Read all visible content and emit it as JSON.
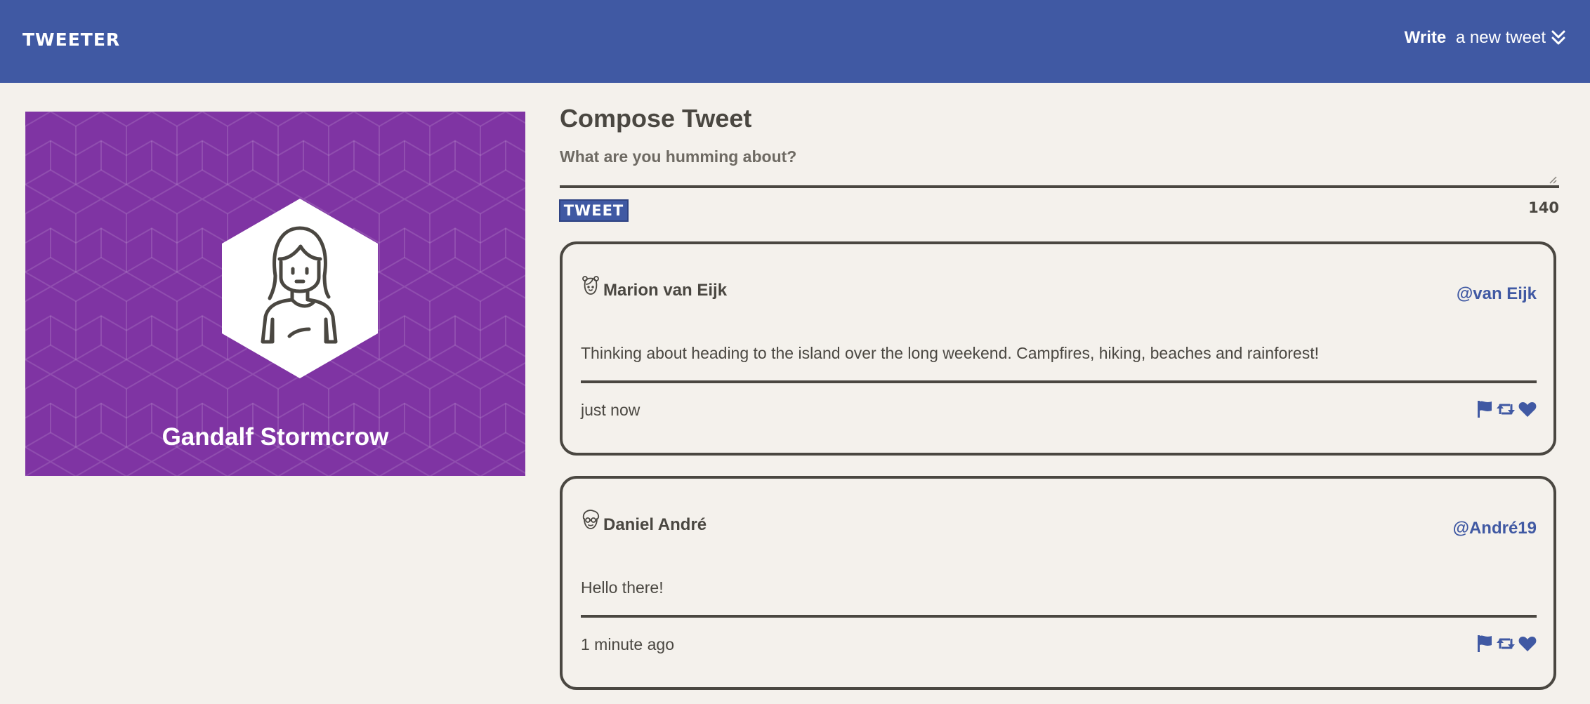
{
  "header": {
    "brand": "Tweeter",
    "write_bold": "Write",
    "write_rest": " a new tweet"
  },
  "profile": {
    "name": "Gandalf Stormcrow",
    "background_color": "#7f34a3"
  },
  "compose": {
    "title": "Compose Tweet",
    "placeholder": "What are you humming about?",
    "button_label": "Tweet",
    "counter": "140"
  },
  "tweets": [
    {
      "name": "Marion van Eijk",
      "handle": "@van Eijk",
      "text": "Thinking about heading to the island over the long weekend. Campfires, hiking, beaches and rainforest!",
      "time": "just now",
      "avatar_icon": "girl-avatar-icon"
    },
    {
      "name": "Daniel André",
      "handle": "@André19",
      "text": "Hello there!",
      "time": "1 minute ago",
      "avatar_icon": "boy-glasses-avatar-icon"
    }
  ],
  "colors": {
    "accent": "#4059a3",
    "text": "#4a4741",
    "background": "#f4f1ec",
    "profile_bg": "#7f34a3"
  },
  "icons": [
    "double-chevron-down-icon",
    "flag-icon",
    "retweet-icon",
    "heart-icon"
  ]
}
